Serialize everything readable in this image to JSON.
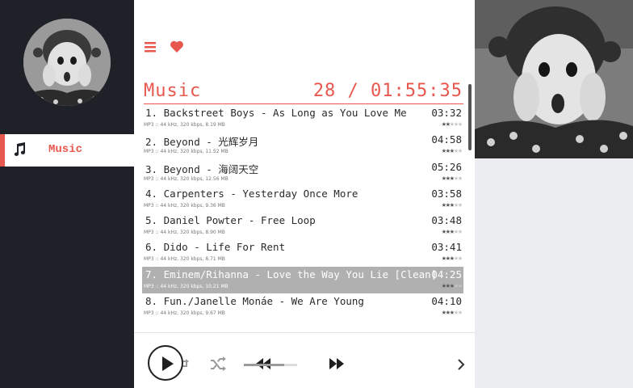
{
  "sidebar": {
    "avatar": "child-photo",
    "nav": [
      {
        "label": "Music",
        "icon": "music-note-icon",
        "active": true
      }
    ]
  },
  "main": {
    "header": {
      "title": "Music",
      "summary": "28 / 01:55:35"
    },
    "tracks": [
      {
        "title": "1. Backstreet Boys - As Long as You Love Me",
        "duration": "03:32",
        "meta": "MP3 :: 44 kHz, 320 kbps, 8.19 MB",
        "rating": 1.5
      },
      {
        "title": "2. Beyond - 光辉岁月",
        "duration": "04:58",
        "meta": "MP3 :: 44 kHz, 320 kbps, 11.52 MB",
        "rating": 3
      },
      {
        "title": "3. Beyond - 海阔天空",
        "duration": "05:26",
        "meta": "MP3 :: 44 kHz, 320 kbps, 12.56 MB",
        "rating": 3
      },
      {
        "title": "4. Carpenters - Yesterday Once More",
        "duration": "03:58",
        "meta": "MP3 :: 44 kHz, 320 kbps, 9.36 MB",
        "rating": 2.5
      },
      {
        "title": "5. Daniel Powter - Free Loop",
        "duration": "03:48",
        "meta": "MP3 :: 44 kHz, 320 kbps, 8.90 MB",
        "rating": 3
      },
      {
        "title": "6. Dido - Life For Rent",
        "duration": "03:41",
        "meta": "MP3 :: 44 kHz, 320 kbps, 8.71 MB",
        "rating": 2.5
      },
      {
        "title": "7. Eminem/Rihanna - Love the Way You Lie [Clean]",
        "duration": "04:25",
        "meta": "MP3 :: 44 kHz, 320 kbps, 10.21 MB",
        "rating": 2.5,
        "active": true
      },
      {
        "title": "8. Fun./Janelle Monáe - We Are Young",
        "duration": "04:10",
        "meta": "MP3 :: 44 kHz, 320 kbps, 9.67 MB",
        "rating": 2.5
      }
    ]
  },
  "player": {
    "controls": [
      "repeat-icon",
      "shuffle-icon",
      "previous-icon",
      "play-icon",
      "next-icon",
      "chevron-right-icon"
    ],
    "volume_fraction": 0.76
  },
  "colors": {
    "accent": "#e8574e",
    "sidebar_bg": "#1e2128",
    "active_row": "#b0b0b0"
  }
}
